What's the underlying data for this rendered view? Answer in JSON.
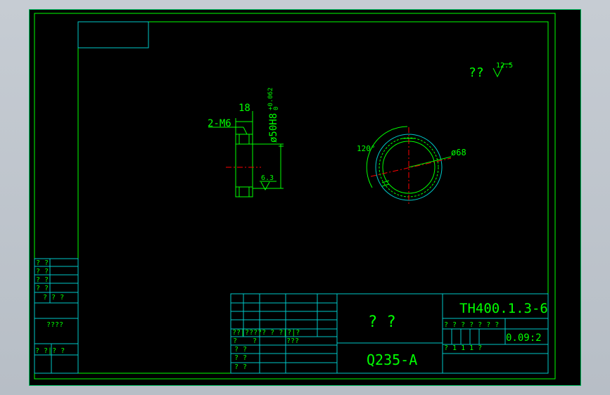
{
  "drawing": {
    "drawing_number": "TH400.1.3-6",
    "material": "Q235-A",
    "part_name": "?  ?",
    "scale": "0.09:2",
    "roughness_note": "??",
    "roughness_value": "12.5"
  },
  "side_view": {
    "thread_callout": "2-M6",
    "dim_width": "18",
    "dim_diameter": "ø50H8",
    "tolerance_upper": "+0.062",
    "tolerance_lower": "0",
    "surface_roughness": "6.3"
  },
  "front_view": {
    "angle": "120°",
    "outer_diameter": "ø68"
  },
  "title_block": {
    "header_row": "??|????? ? ?|?|?",
    "row1_left": "?",
    "row1_mid": "?",
    "row1_right": "???",
    "rows": [
      "?   ?",
      "?   ?",
      "?   ?",
      "?   ?"
    ],
    "info_row": "? ? ? ?   ? ? ?",
    "count_row": "?  1       1      1    ?"
  },
  "left_block": {
    "rows": [
      "?  ?",
      "?  ?",
      "?  ?",
      "?  ?",
      "? ? ?"
    ],
    "mid_label": "????",
    "bottom_label": "? ?|?    ?"
  },
  "colors": {
    "frame": "#00ff00",
    "table": "#00c8c8",
    "centerline": "#ff0000",
    "background": "#000000"
  }
}
